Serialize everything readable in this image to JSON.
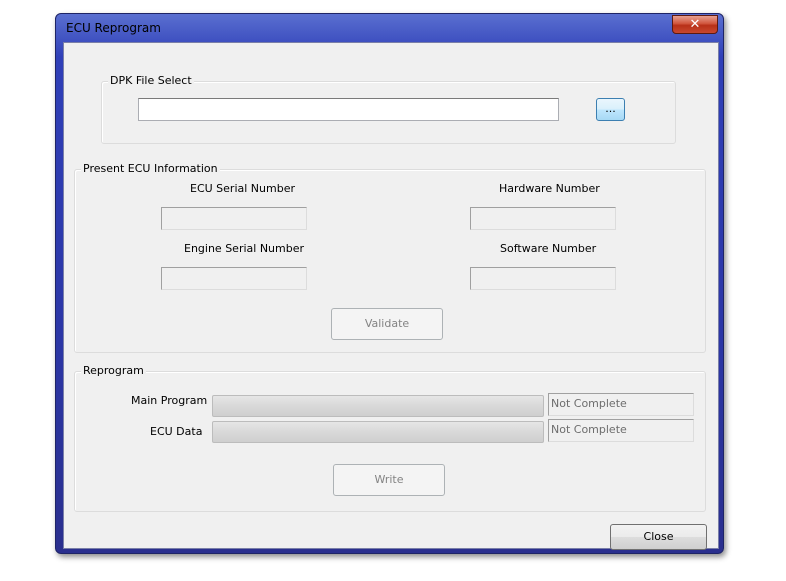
{
  "window": {
    "title": "ECU Reprogram",
    "close_glyph": "✕"
  },
  "dpk": {
    "group_label": "DPK File Select",
    "file_path": "",
    "browse_label": "..."
  },
  "ecu_info": {
    "group_label": "Present ECU Information",
    "ecu_serial_label": "ECU Serial Number",
    "ecu_serial_value": "",
    "hardware_label": "Hardware Number",
    "hardware_value": "",
    "engine_serial_label": "Engine Serial Number",
    "engine_serial_value": "",
    "software_label": "Software Number",
    "software_value": "",
    "validate_label": "Validate"
  },
  "reprogram": {
    "group_label": "Reprogram",
    "main_program_label": "Main Program",
    "main_program_progress": 0,
    "main_program_status": "Not Complete",
    "ecu_data_label": "ECU Data",
    "ecu_data_progress": 0,
    "ecu_data_status": "Not Complete",
    "write_label": "Write"
  },
  "footer": {
    "close_label": "Close"
  },
  "colors": {
    "title_bar": "#2f3fb8",
    "close_button": "#c8482e",
    "client_bg": "#f0f0f0"
  },
  "icons": {
    "close": "close-icon"
  }
}
